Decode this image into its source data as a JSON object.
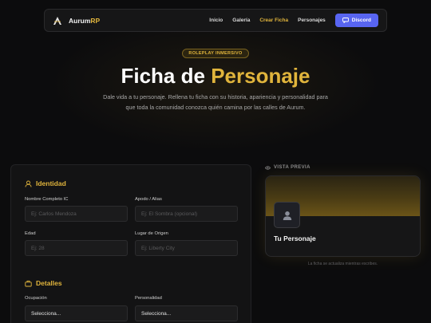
{
  "nav": {
    "brand_main": "Aurum",
    "brand_accent": "RP",
    "links": [
      "Inicio",
      "Galería",
      "Crear Ficha",
      "Personajes"
    ],
    "active_link": "Crear Ficha",
    "discord_label": "Discord"
  },
  "hero": {
    "badge": "ROLEPLAY INMERSIVO",
    "title_main": "Ficha de",
    "title_accent": "Personaje",
    "subtitle": "Dale vida a tu personaje. Rellena tu ficha con su historia, apariencia y personalidad para que toda la comunidad conozca quién camina por las calles de Aurum."
  },
  "form": {
    "identity": {
      "heading": "Identidad",
      "full_name_label": "Nombre Completo IC",
      "full_name_placeholder": "Ej: Carlos Mendoza",
      "alias_label": "Apodo / Alias",
      "alias_placeholder": "Ej: El Sombra (opcional)",
      "age_label": "Edad",
      "age_placeholder": "Ej: 28",
      "origin_label": "Lugar de Origen",
      "origin_placeholder": "Ej: Liberty City"
    },
    "details": {
      "heading": "Detalles",
      "occupation_label": "Ocupación",
      "occupation_value": "Selecciona...",
      "personality_label": "Personalidad",
      "personality_value": "Selecciona..."
    }
  },
  "preview": {
    "label": "VISTA PREVIA",
    "name": "Tu Personaje",
    "note": "La ficha se actualiza mientras escribes."
  },
  "colors": {
    "accent": "#e0b43c",
    "discord": "#5865f2",
    "background": "#0c0c0d"
  }
}
